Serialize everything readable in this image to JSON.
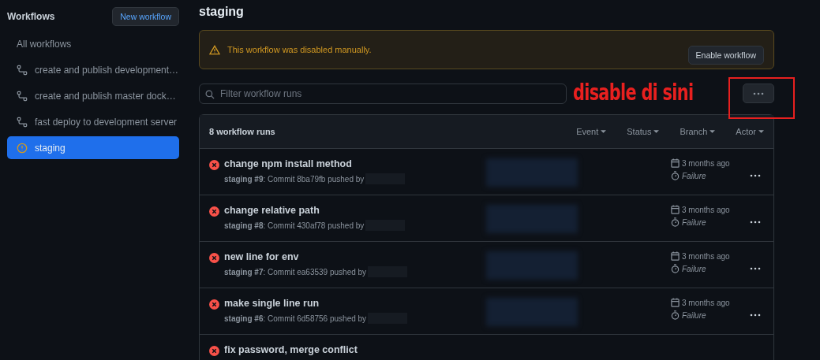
{
  "sidebar": {
    "title": "Workflows",
    "new_button": "New workflow",
    "items": [
      {
        "label": "All workflows",
        "kind": "all",
        "selected": false
      },
      {
        "label": "create and publish development…",
        "kind": "workflow",
        "selected": false
      },
      {
        "label": "create and publish master dock…",
        "kind": "workflow",
        "selected": false
      },
      {
        "label": "fast deploy to development server",
        "kind": "workflow",
        "selected": false
      },
      {
        "label": "staging",
        "kind": "disabled",
        "selected": true
      }
    ]
  },
  "page_title": "staging",
  "banner": {
    "message": "This workflow was disabled manually.",
    "button": "Enable workflow"
  },
  "filter": {
    "placeholder": "Filter workflow runs"
  },
  "annotation": {
    "text": "disable di sini"
  },
  "runs": {
    "count": "8 workflow runs",
    "filters": [
      "Event",
      "Status",
      "Branch",
      "Actor"
    ],
    "rows": [
      {
        "kind": "failure",
        "title": "change npm install method",
        "subtitle": "**staging #9**: Commit 8ba79fb pushed by",
        "time": "3 months ago",
        "status": "Failure"
      },
      {
        "kind": "failure",
        "title": "change relative path",
        "subtitle": "**staging #8**: Commit 430af78 pushed by",
        "time": "3 months ago",
        "status": "Failure"
      },
      {
        "kind": "failure",
        "title": "new line for env",
        "subtitle": "**staging #7**: Commit ea63539 pushed by",
        "time": "3 months ago",
        "status": "Failure"
      },
      {
        "kind": "failure",
        "title": "make single line run",
        "subtitle": "**staging #6**: Commit 6d58756 pushed by",
        "time": "3 months ago",
        "status": "Failure"
      },
      {
        "kind": "failure",
        "title": "fix password, merge conflict"
      }
    ]
  }
}
